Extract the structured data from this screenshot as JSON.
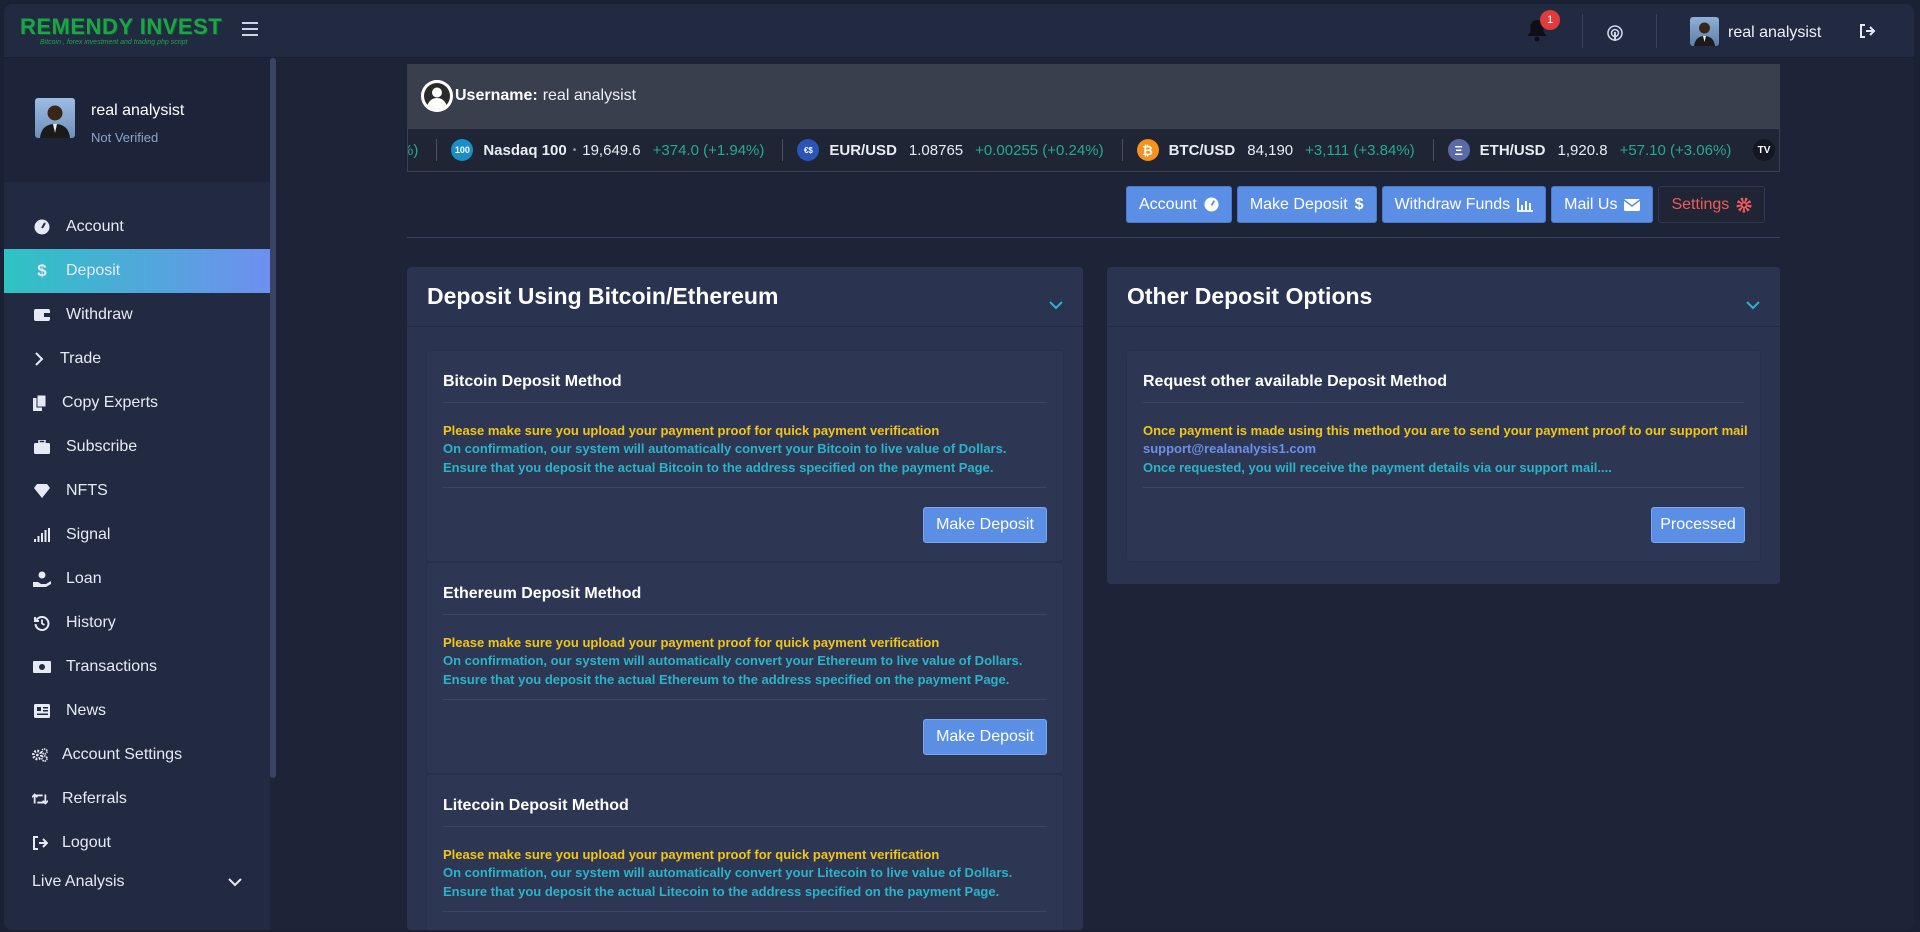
{
  "app": {
    "logo_text": "REMENDY INVEST",
    "logo_tagline": "Bitcoin , forex investment and trading php script",
    "notification_count": "1",
    "user_name": "real analysist"
  },
  "sidebar": {
    "profile_name": "real analysist",
    "profile_status": "Not Verified",
    "items": [
      {
        "label": "Account",
        "icon": "dashboard-gauge-icon"
      },
      {
        "label": "Deposit",
        "icon": "dollar-sign-icon"
      },
      {
        "label": "Withdraw",
        "icon": "wallet-icon"
      },
      {
        "label": "Trade",
        "icon": "chevron-right-icon"
      },
      {
        "label": "Copy Experts",
        "icon": "copy-icon"
      },
      {
        "label": "Subscribe",
        "icon": "briefcase-icon"
      },
      {
        "label": "NFTS",
        "icon": "gem-icon"
      },
      {
        "label": "Signal",
        "icon": "signal-bars-icon"
      },
      {
        "label": "Loan",
        "icon": "hand-holding-dollar-icon"
      },
      {
        "label": "History",
        "icon": "history-icon"
      },
      {
        "label": "Transactions",
        "icon": "money-bill-icon"
      },
      {
        "label": "News",
        "icon": "newspaper-icon"
      },
      {
        "label": "Account Settings",
        "icon": "cogs-icon"
      },
      {
        "label": "Referrals",
        "icon": "retweet-icon"
      },
      {
        "label": "Logout",
        "icon": "sign-out-icon"
      }
    ],
    "live_analysis": "Live Analysis"
  },
  "userbar": {
    "label": "Username:",
    "value": "real analysist"
  },
  "ticker": [
    {
      "symbol": "",
      "price": "",
      "change": "%)",
      "badge": ""
    },
    {
      "symbol": "Nasdaq 100",
      "price": "19,649.6",
      "change": "+374.0 (+1.94%)",
      "badge": "100",
      "color": "#1a8fc7",
      "dot": "•"
    },
    {
      "symbol": "EUR/USD",
      "price": "1.08765",
      "change": "+0.00255 (+0.24%)",
      "badge": "€$",
      "color": "#2a55b8"
    },
    {
      "symbol": "BTC/USD",
      "price": "84,190",
      "change": "+3,111 (+3.84%)",
      "badge": "₿",
      "color": "#f7931a"
    },
    {
      "symbol": "ETH/USD",
      "price": "1,920.8",
      "change": "+57.10 (+3.06%)",
      "badge": "Ξ",
      "color": "#5a6aa8"
    }
  ],
  "tradingview_logo": "TV",
  "actions": {
    "account": "Account",
    "make_deposit": "Make Deposit",
    "withdraw_funds": "Withdraw Funds",
    "mail_us": "Mail Us",
    "settings": "Settings"
  },
  "crypto_card": {
    "title": "Deposit Using Bitcoin/Ethereum",
    "methods": [
      {
        "title": "Bitcoin Deposit Method",
        "warning": "Please make sure you upload your payment proof for quick payment verification",
        "desc": "On confirmation, our system will automatically convert your Bitcoin to live value of Dollars. Ensure that you deposit the actual Bitcoin to the address specified on the payment Page.",
        "button": "Make Deposit"
      },
      {
        "title": "Ethereum Deposit Method",
        "warning": "Please make sure you upload your payment proof for quick payment verification",
        "desc": "On confirmation, our system will automatically convert your Ethereum to live value of Dollars. Ensure that you deposit the actual Ethereum to the address specified on the payment Page.",
        "button": "Make Deposit"
      },
      {
        "title": "Litecoin Deposit Method",
        "warning": "Please make sure you upload your payment proof for quick payment verification",
        "desc": "On confirmation, our system will automatically convert your Litecoin to live value of Dollars. Ensure that you deposit the actual Litecoin to the address specified on the payment Page."
      }
    ]
  },
  "other_card": {
    "title": "Other Deposit Options",
    "method_title": "Request other available Deposit Method",
    "warning": "Once payment is made using this method you are to send your payment proof to our support mail",
    "email": "support@realanalysis1.com",
    "desc": "Once requested, you will receive the payment details via our support mail....",
    "button": "Processed"
  },
  "colors": {
    "accent": "#5b8fe6",
    "active_gradient_start": "#2ec3c3",
    "active_gradient_end": "#6e8ff0",
    "warning": "#f3c515",
    "info": "#2bb3c8",
    "positive": "#22ab94",
    "danger": "#ef5b5b"
  }
}
